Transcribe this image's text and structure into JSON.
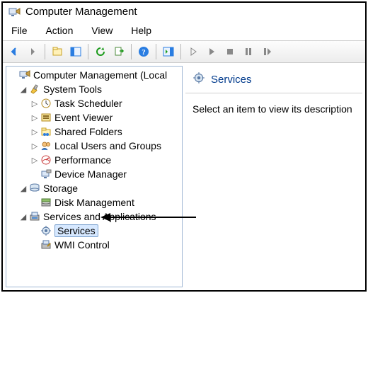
{
  "window": {
    "title": "Computer Management"
  },
  "menubar": {
    "file": "File",
    "action": "Action",
    "view": "View",
    "help": "Help"
  },
  "toolbar": {
    "back": "Back",
    "forward": "Forward",
    "up": "Up one level",
    "properties": "Show/Hide Console Tree",
    "refresh": "Refresh",
    "export": "Export List",
    "help": "Help",
    "actionpane": "Show/Hide Action Pane",
    "start": "Start",
    "play": "Resume",
    "stop": "Stop",
    "pause": "Pause",
    "restart": "Restart"
  },
  "tree": {
    "root": "Computer Management (Local",
    "systools": "System Tools",
    "taskScheduler": "Task Scheduler",
    "eventViewer": "Event Viewer",
    "sharedFolders": "Shared Folders",
    "localUsers": "Local Users and Groups",
    "performance": "Performance",
    "deviceManager": "Device Manager",
    "storage": "Storage",
    "diskMgmt": "Disk Management",
    "servicesApps": "Services and Applications",
    "services": "Services",
    "wmi": "WMI Control"
  },
  "detail": {
    "header": "Services",
    "body": "Select an item to view its description"
  }
}
